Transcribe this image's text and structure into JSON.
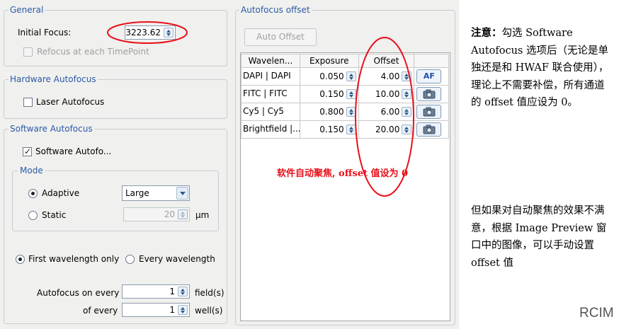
{
  "general": {
    "title": "General",
    "initial_focus_label": "Initial Focus:",
    "initial_focus_value": "3223.62",
    "refocus_label": "Refocus at each TimePoint"
  },
  "hardware": {
    "title": "Hardware Autofocus",
    "laser_label": "Laser Autofocus"
  },
  "software": {
    "title": "Software Autofocus",
    "software_label": "Software Autofo...",
    "mode_title": "Mode",
    "adaptive_label": "Adaptive",
    "adaptive_option": "Large",
    "static_label": "Static",
    "static_value": "20",
    "static_unit": "µm",
    "first_wavelength_label": "First wavelength only",
    "every_wavelength_label": "Every wavelength",
    "af_every_label": "Autofocus on every",
    "af_every_value": "1",
    "af_every_unit": "field(s)",
    "of_every_label": "of every",
    "of_every_value": "1",
    "of_every_unit": "well(s)"
  },
  "offset": {
    "title": "Autofocus offset",
    "auto_offset_button": "Auto Offset",
    "columns": [
      "Wavelen...",
      "Exposure",
      "Offset"
    ],
    "rows": [
      {
        "name": "DAPI | DAPI",
        "exposure": "0.050",
        "offset": "4.00",
        "button": "AF"
      },
      {
        "name": "FITC | FITC",
        "exposure": "0.150",
        "offset": "10.00",
        "button": "camera"
      },
      {
        "name": "Cy5 | Cy5",
        "exposure": "0.800",
        "offset": "6.00",
        "button": "camera"
      },
      {
        "name": "Brightfield |...",
        "exposure": "0.150",
        "offset": "20.00",
        "button": "camera"
      }
    ],
    "annotation": "软件自动聚焦, offset 值设为 0"
  },
  "note": {
    "p1_bold": "注意：",
    "p1_text": "勾选 Software Autofocus 选项后（无论是单独还是和 HWAF 联合使用），理论上不需要补偿，所有通道的 offset 值应设为 0。",
    "p2_text": "但如果对自动聚焦的效果不满意，根据 Image Preview 窗口中的图像，可以手动设置 offset 值",
    "brand": "RCIM"
  },
  "colors": {
    "panel_bg": "#f0f0ee",
    "group_title": "#2a5aa8",
    "annotation_red": "#e8101a"
  }
}
